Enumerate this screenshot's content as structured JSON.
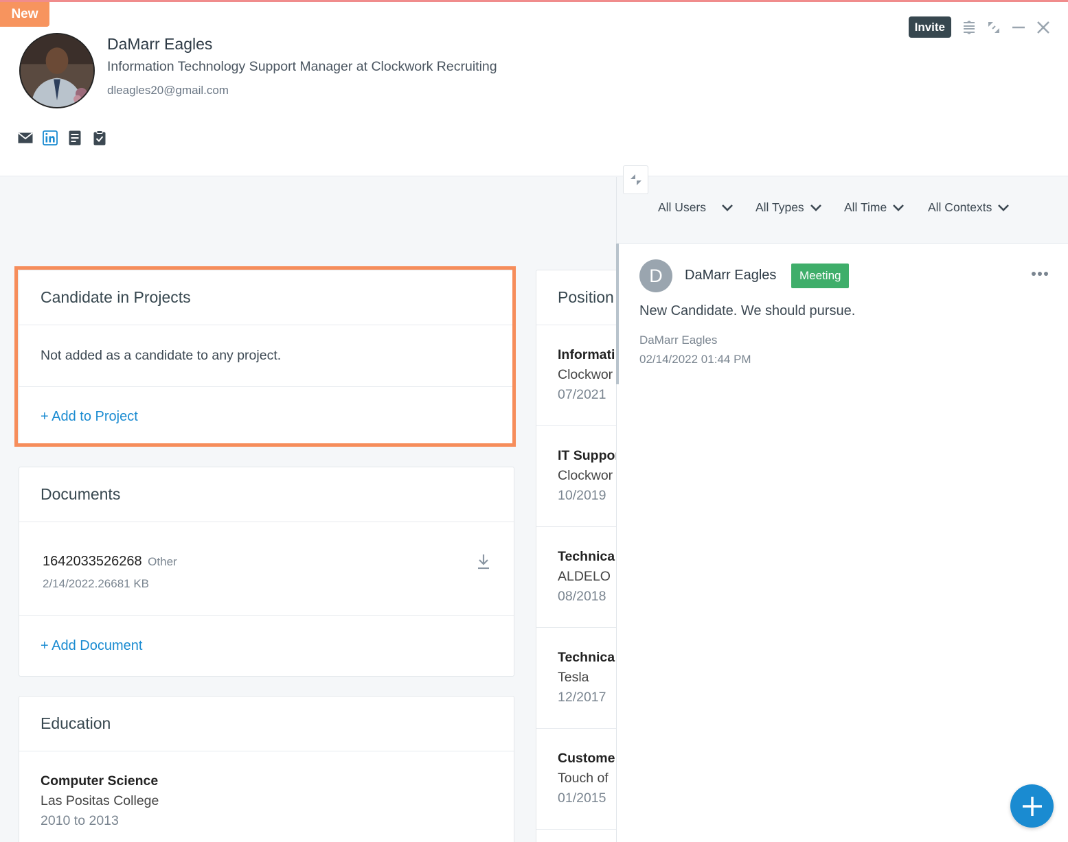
{
  "header": {
    "badge": "New",
    "name": "DaMarr Eagles",
    "title": "Information Technology Support Manager at Clockwork Recruiting",
    "email": "dleagles20@gmail.com",
    "invite_label": "Invite"
  },
  "projects_card": {
    "heading": "Candidate in Projects",
    "empty_text": "Not added as a candidate to any project.",
    "add_link": "+ Add to Project"
  },
  "documents_card": {
    "heading": "Documents",
    "items": [
      {
        "name": "1642033526268",
        "type": "Other",
        "meta": "2/14/2022.26681 KB"
      }
    ],
    "add_link": "+ Add Document"
  },
  "education_card": {
    "heading": "Education",
    "items": [
      {
        "field": "Computer Science",
        "school": "Las Positas College",
        "years": "2010 to 2013"
      }
    ]
  },
  "positions_card": {
    "heading": "Position",
    "items": [
      {
        "title": "Informati",
        "company": "Clockwor",
        "date": "07/2021"
      },
      {
        "title": "IT Suppor",
        "company": "Clockwor",
        "date": "10/2019"
      },
      {
        "title": "Technica",
        "company": "ALDELO",
        "date": "08/2018"
      },
      {
        "title": "Technica",
        "company": "Tesla",
        "date": "12/2017"
      },
      {
        "title": "Custome",
        "company": "Touch of",
        "date": "01/2015"
      }
    ]
  },
  "activity": {
    "filters": [
      "All Users",
      "All Types",
      "All Time",
      "All Contexts"
    ],
    "items": [
      {
        "initial": "D",
        "author": "DaMarr Eagles",
        "type": "Meeting",
        "text": "New Candidate. We should pursue.",
        "by": "DaMarr Eagles",
        "timestamp": "02/14/2022 01:44 PM"
      }
    ]
  },
  "colors": {
    "accent": "#1a8bd1",
    "new_badge": "#f7945e",
    "meeting_badge": "#3fae6a",
    "highlight": "#f68d5b"
  },
  "icons": {
    "social": [
      "mail-icon",
      "linkedin-icon",
      "document-icon",
      "clipboard-check-icon"
    ],
    "window": [
      "compact-icon",
      "expand-icon",
      "minimize-icon",
      "close-icon"
    ]
  }
}
